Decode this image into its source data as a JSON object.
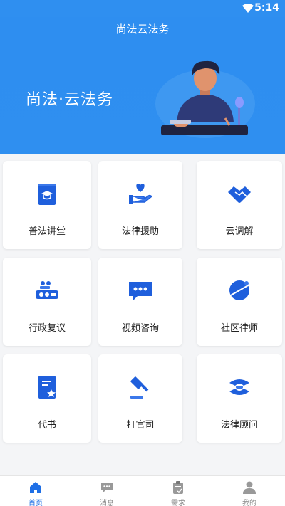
{
  "status": {
    "time": "5:14"
  },
  "header": {
    "app_title": "尚法云法务",
    "banner_title": "尚法·云法务"
  },
  "services": [
    {
      "label": "普法讲堂",
      "icon": "graduation-book-icon"
    },
    {
      "label": "法律援助",
      "icon": "hand-heart-icon"
    },
    {
      "label": "云调解",
      "icon": "handshake-icon"
    },
    {
      "label": "行政复议",
      "icon": "meeting-table-icon"
    },
    {
      "label": "视频咨询",
      "icon": "chat-bubble-icon"
    },
    {
      "label": "社区律师",
      "icon": "globe-chat-icon"
    },
    {
      "label": "代书",
      "icon": "document-star-icon"
    },
    {
      "label": "打官司",
      "icon": "gavel-icon"
    },
    {
      "label": "法律顾问",
      "icon": "hands-support-icon"
    }
  ],
  "tabs": [
    {
      "label": "首页",
      "icon": "home-icon",
      "active": true
    },
    {
      "label": "消息",
      "icon": "message-icon",
      "active": false
    },
    {
      "label": "需求",
      "icon": "clipboard-check-icon",
      "active": false
    },
    {
      "label": "我的",
      "icon": "user-icon",
      "active": false
    }
  ],
  "colors": {
    "primary": "#2f8ff0",
    "icon_blue": "#1f5fdc",
    "tab_active": "#1e6fe6"
  }
}
